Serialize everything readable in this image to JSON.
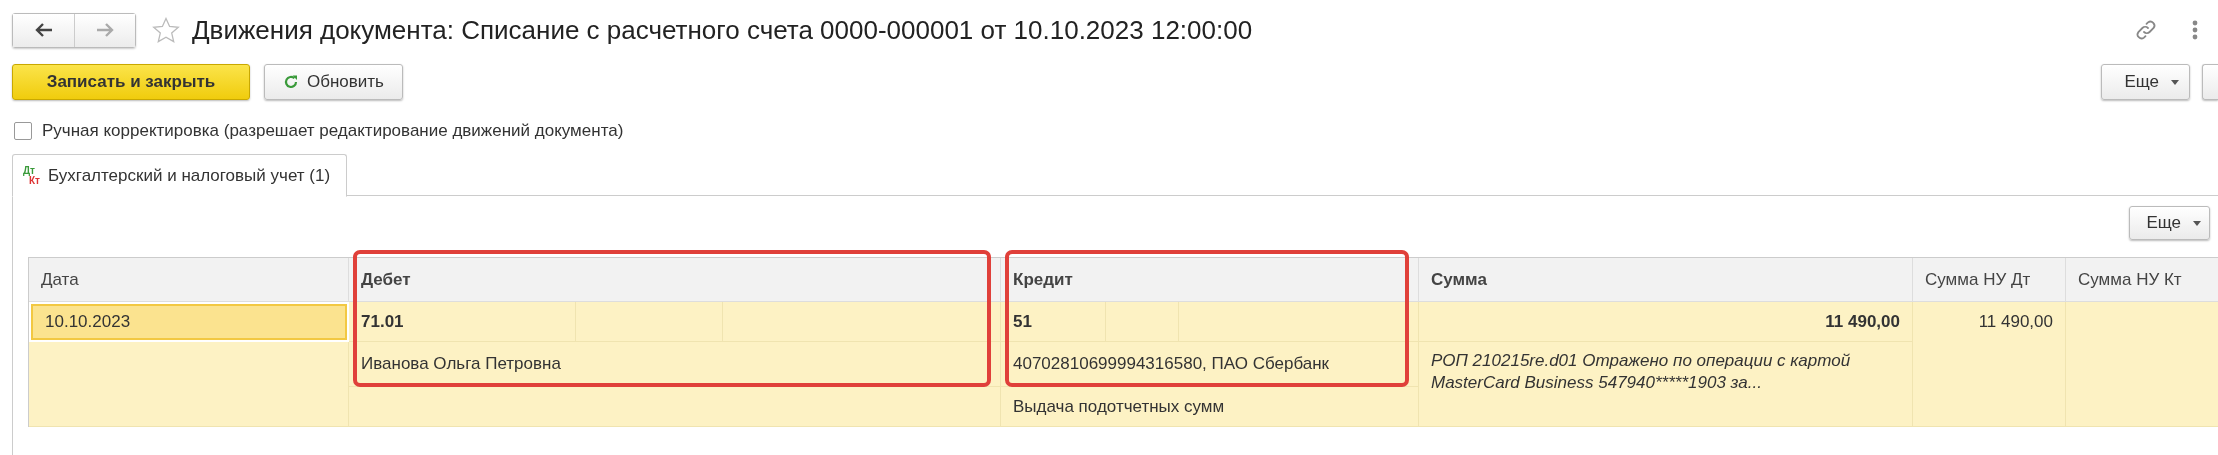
{
  "window": {
    "title": "Движения документа: Списание с расчетного счета 0000-000001 от 10.10.2023 12:00:00"
  },
  "toolbar": {
    "buttons": [
      {
        "label": "Записать и закрыть",
        "kind": "primary"
      },
      {
        "label": "Обновить",
        "kind": "refresh"
      }
    ],
    "more": "Еще"
  },
  "manual_edit": {
    "label": "Ручная корректировка (разрешает редактирование движений документа)",
    "checked": false
  },
  "tabs": [
    {
      "label": "Бухгалтерский и налоговый учет (1)",
      "icon_top": "Дт",
      "icon_bottom": "Кт",
      "selected": true
    }
  ],
  "table_toolbar": {
    "more": "Еще"
  },
  "table": {
    "columns": [
      {
        "label": "Дата",
        "bold": false,
        "framed": false
      },
      {
        "label": "Дебет",
        "bold": true,
        "framed": true
      },
      {
        "label": "Кредит",
        "bold": true,
        "framed": true
      },
      {
        "label": "Сумма",
        "bold": true,
        "framed": false
      },
      {
        "label": "Сумма НУ Дт",
        "bold": false,
        "framed": false
      },
      {
        "label": "Сумма НУ Кт",
        "bold": false,
        "framed": false
      }
    ],
    "record": {
      "date": {
        "text": "10.10.2023",
        "selected": true
      },
      "debit": {
        "account": "71.01",
        "subconto": [
          "Иванова Ольга Петровна"
        ]
      },
      "credit": {
        "account": "51",
        "subconto": [
          "40702810699994316580, ПАО Сбербанк",
          "Выдача подотчетных сумм"
        ]
      },
      "amount": "11 490,00",
      "comment": "РОП 210215re.d01 Отражено по операции с картой MasterCard Business 547940*****1903 за...",
      "amount_nu_dt": "11 490,00"
    }
  }
}
